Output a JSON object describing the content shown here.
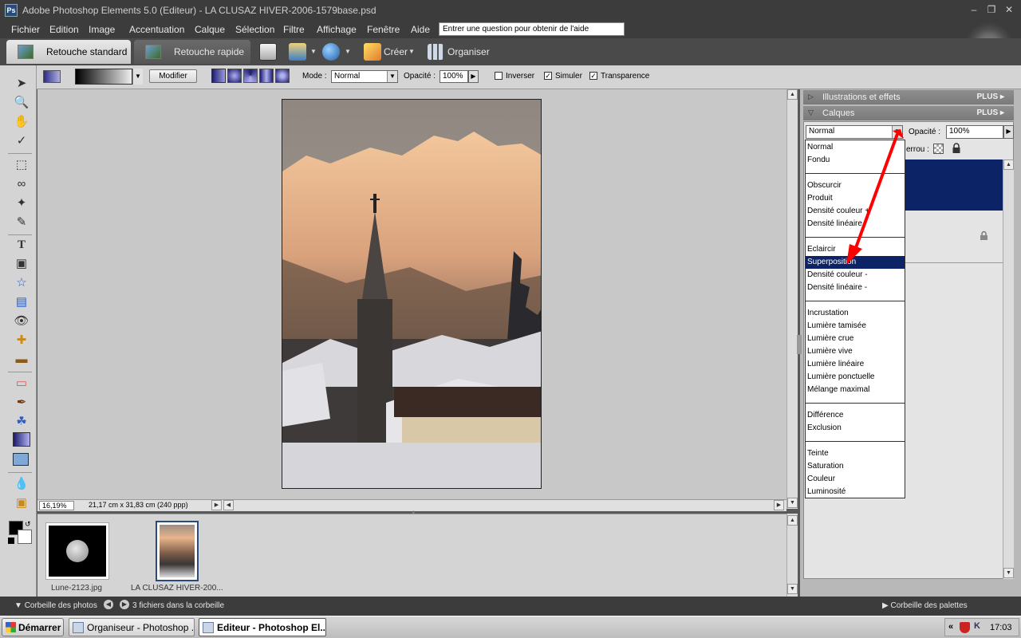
{
  "window": {
    "title": "Adobe Photoshop Elements 5.0 (Editeur) - LA CLUSAZ HIVER-2006-1579base.psd",
    "app_icon_label": "Ps"
  },
  "menu": [
    "Fichier",
    "Edition",
    "Image",
    "Accentuation",
    "Calque",
    "Sélection",
    "Filtre",
    "Affichage",
    "Fenêtre",
    "Aide"
  ],
  "help_box": {
    "value": "Entrer une question pour obtenir de l'aide"
  },
  "mode_tabs": [
    {
      "label": "Retouche standard",
      "active": true
    },
    {
      "label": "Retouche rapide",
      "active": false
    }
  ],
  "toolbar": {
    "create_label": "Créer",
    "organize_label": "Organiser"
  },
  "options_bar": {
    "edit_button": "Modifier",
    "mode_label": "Mode :",
    "mode_value": "Normal",
    "opacity_label": "Opacité :",
    "opacity_value": "100%",
    "invert_label": "Inverser",
    "invert_checked": false,
    "dither_label": "Simuler",
    "dither_checked": true,
    "transparency_label": "Transparence",
    "transparency_checked": true
  },
  "status": {
    "zoom": "16,19%",
    "doc_size": "21,17 cm x 31,83 cm (240 ppp)"
  },
  "photo_bin": {
    "items": [
      {
        "label": "Lune-2123.jpg",
        "selected": false
      },
      {
        "label": "LA CLUSAZ HIVER-200...",
        "selected": true
      }
    ],
    "footer_label": "Corbeille des photos",
    "count_label": "3 fichiers dans la corbeille"
  },
  "palettes": {
    "effects_title": "Illustrations et effets",
    "layers_title": "Calques",
    "plus_label": "PLUS",
    "blend_value": "Normal",
    "opacity_label": "Opacité :",
    "opacity_value": "100%",
    "lock_label": "errou :",
    "footer_label": "Corbeille des palettes"
  },
  "blend_menu": {
    "groups": [
      [
        "Normal",
        "Fondu"
      ],
      [
        "Obscurcir",
        "Produit",
        "Densité couleur +",
        "Densité linéaire"
      ],
      [
        "Eclaircir",
        "Superposition",
        "Densité couleur -",
        "Densité linéaire -"
      ],
      [
        "Incrustation",
        "Lumière tamisée",
        "Lumière crue",
        "Lumière vive",
        "Lumière linéaire",
        "Lumière ponctuelle",
        "Mélange maximal"
      ],
      [
        "Différence",
        "Exclusion"
      ],
      [
        "Teinte",
        "Saturation",
        "Couleur",
        "Luminosité"
      ]
    ],
    "selected": "Superposition"
  },
  "taskbar": {
    "start_label": "Démarrer",
    "tasks": [
      {
        "label": "Organiseur - Photoshop ...",
        "active": false
      },
      {
        "label": "Editeur - Photoshop El...",
        "active": true
      }
    ],
    "clock": "17:03"
  },
  "colors": {
    "dark_chrome": "#3c3c3c",
    "panel_gray": "#d4d4d4",
    "selection_navy": "#0c2465",
    "annotation_red": "#ff0000"
  }
}
